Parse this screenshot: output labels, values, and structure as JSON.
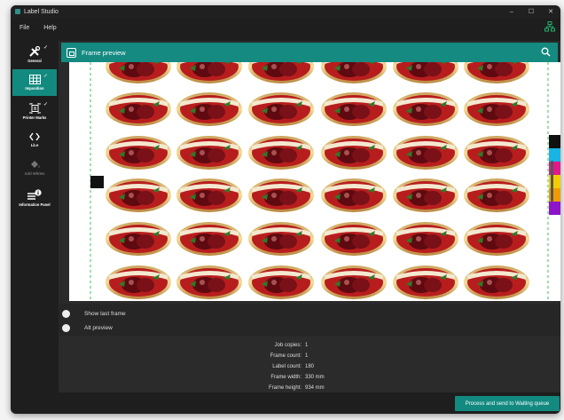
{
  "window": {
    "title": "Label Studio",
    "controls": [
      "–",
      "☐",
      "✕"
    ]
  },
  "menu": {
    "file": "File",
    "help": "Help"
  },
  "sidebar": {
    "items": [
      {
        "label": "General",
        "icon": "tools-icon",
        "checked": true,
        "state": "normal"
      },
      {
        "label": "Imposition",
        "icon": "grid-icon",
        "checked": true,
        "state": "active"
      },
      {
        "label": "Printer Marks",
        "icon": "crop-marks-icon",
        "checked": true,
        "state": "normal"
      },
      {
        "label": "LiLe",
        "icon": "code-brackets-icon",
        "checked": false,
        "state": "normal"
      },
      {
        "label": "Add Whites",
        "icon": "paint-bucket-icon",
        "checked": false,
        "state": "disabled"
      },
      {
        "label": "Information Panel",
        "icon": "info-panel-icon",
        "checked": false,
        "state": "normal"
      }
    ]
  },
  "preview": {
    "title": "Frame preview"
  },
  "options": {
    "show_last_frame": "Show last frame",
    "alt_preview": "Alt preview"
  },
  "info": [
    {
      "key": "Job copies:",
      "value": "1"
    },
    {
      "key": "Frame count:",
      "value": "1"
    },
    {
      "key": "Label count:",
      "value": "180"
    },
    {
      "key": "Frame width:",
      "value": "330 mm"
    },
    {
      "key": "Frame height:",
      "value": "934 mm"
    }
  ],
  "actions": {
    "process": "Process and send to Waiting queue"
  },
  "colors": {
    "accent": "#138a80",
    "color_bar": [
      "#111111",
      "#1ab3e6",
      "#e0188c",
      "#f5cc00",
      "#f09a00",
      "#8f14c8"
    ]
  }
}
